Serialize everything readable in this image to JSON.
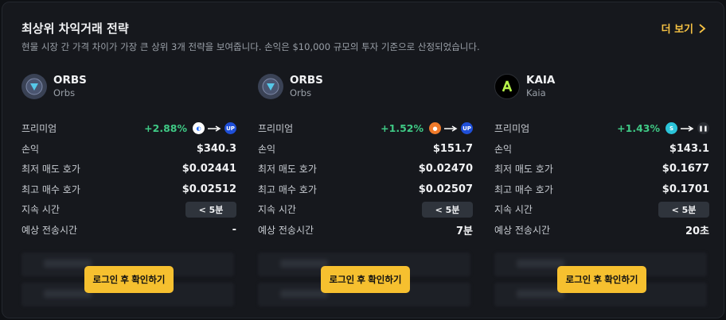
{
  "header": {
    "title": "최상위 차익거래 전략",
    "subtitle": "현물 시장 간 가격 차이가 가장 큰 상위 3개 전략을 보여줍니다. 손익은 $10,000 규모의 투자 기준으로 산정되었습니다.",
    "more_label": "더 보기"
  },
  "labels": {
    "premium": "프리미엄",
    "pnl": "손익",
    "lowest_ask": "최저 매도 호가",
    "highest_bid": "최고 매수 호가",
    "duration": "지속 시간",
    "transfer_time": "예상 전송시간",
    "login": "로그인 후 확인하기"
  },
  "cards": [
    {
      "symbol": "ORBS",
      "name": "Orbs",
      "coin_icon": "orbs-icon",
      "premium": "+2.88%",
      "from_exchange": "exchange-a-icon",
      "to_exchange": "upbit-icon",
      "pnl": "$340.3",
      "lowest_ask": "$0.02441",
      "highest_bid": "$0.02512",
      "duration": "< 5분",
      "transfer_time": "-"
    },
    {
      "symbol": "ORBS",
      "name": "Orbs",
      "coin_icon": "orbs-icon",
      "premium": "+1.52%",
      "from_exchange": "exchange-b-icon",
      "to_exchange": "upbit-icon",
      "pnl": "$151.7",
      "lowest_ask": "$0.02470",
      "highest_bid": "$0.02507",
      "duration": "< 5분",
      "transfer_time": "7분"
    },
    {
      "symbol": "KAIA",
      "name": "Kaia",
      "coin_icon": "kaia-icon",
      "premium": "+1.43%",
      "from_exchange": "exchange-c-icon",
      "to_exchange": "exchange-d-icon",
      "pnl": "$143.1",
      "lowest_ask": "$0.1677",
      "highest_bid": "$0.1701",
      "duration": "< 5분",
      "transfer_time": "20초"
    }
  ],
  "colors": {
    "accent": "#f6c244",
    "positive": "#3fc985",
    "button": "#f6c02f"
  }
}
